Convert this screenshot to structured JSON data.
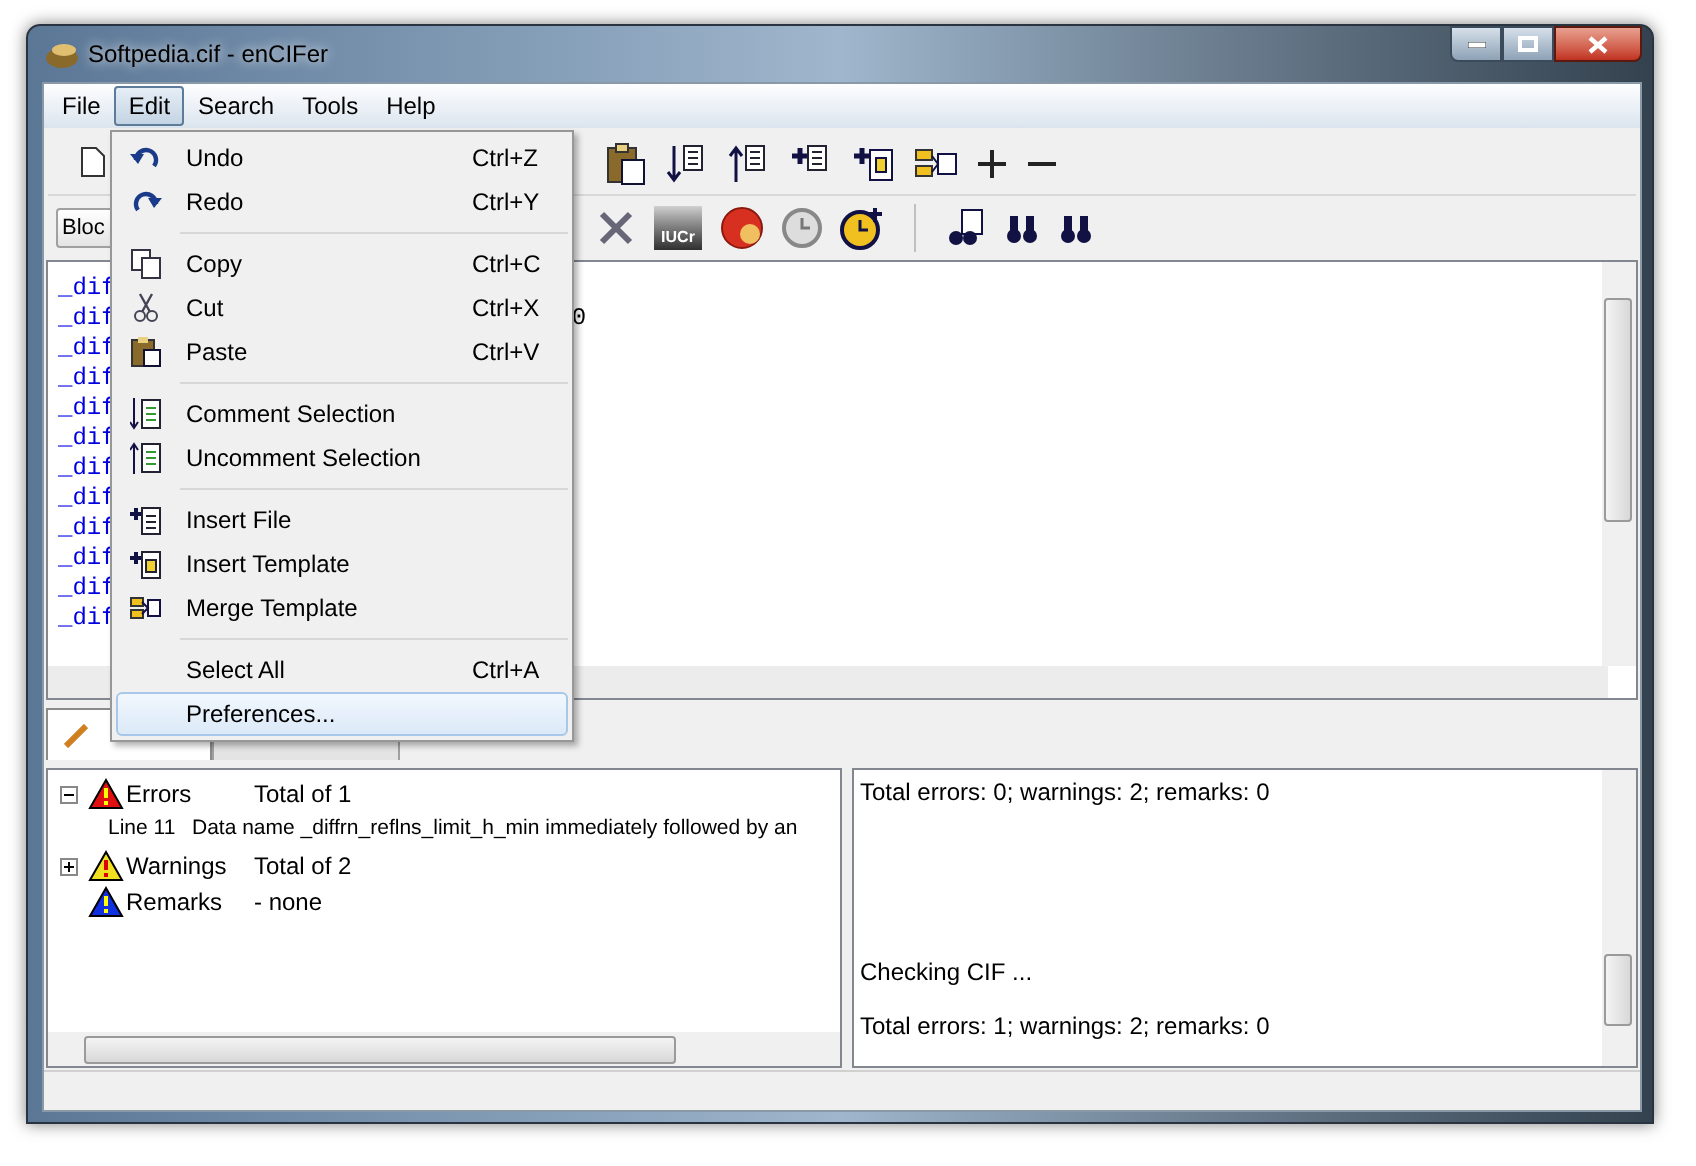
{
  "window": {
    "title": "Softpedia.cif - enCIFer"
  },
  "menu_bar": [
    {
      "label": "File",
      "selected": false
    },
    {
      "label": "Edit",
      "selected": true
    },
    {
      "label": "Search",
      "selected": false
    },
    {
      "label": "Tools",
      "selected": false
    },
    {
      "label": "Help",
      "selected": false
    }
  ],
  "toolbar_2": {
    "block_combo": "Bloc",
    "iucr_label": "IUCr"
  },
  "editor": {
    "lines": [
      {
        "text": "_dif"
      },
      {
        "text": "_dif",
        "tail": "0"
      },
      {
        "text": "_dif"
      },
      {
        "text": "_dif"
      },
      {
        "text": "_dif"
      },
      {
        "text": "_dif"
      },
      {
        "text": "_dif"
      },
      {
        "text": "_dif"
      },
      {
        "text": "_dif"
      },
      {
        "text": "_dif"
      },
      {
        "text": "_dif"
      },
      {
        "text": "_dif"
      }
    ]
  },
  "tabs": [
    {
      "selected": true
    },
    {
      "selected": false
    }
  ],
  "edit_menu": [
    {
      "kind": "item",
      "label": "Undo",
      "shortcut": "Ctrl+Z",
      "selected": false
    },
    {
      "kind": "item",
      "label": "Redo",
      "shortcut": "Ctrl+Y",
      "selected": false
    },
    {
      "kind": "separator"
    },
    {
      "kind": "item",
      "label": "Copy",
      "shortcut": "Ctrl+C",
      "selected": false
    },
    {
      "kind": "item",
      "label": "Cut",
      "shortcut": "Ctrl+X",
      "selected": false
    },
    {
      "kind": "item",
      "label": "Paste",
      "shortcut": "Ctrl+V",
      "selected": false
    },
    {
      "kind": "separator"
    },
    {
      "kind": "item",
      "label": "Comment Selection",
      "selected": false
    },
    {
      "kind": "item",
      "label": "Uncomment Selection",
      "selected": false
    },
    {
      "kind": "separator"
    },
    {
      "kind": "item",
      "label": "Insert File",
      "selected": false
    },
    {
      "kind": "item",
      "label": "Insert Template",
      "selected": false
    },
    {
      "kind": "item",
      "label": "Merge Template",
      "selected": false
    },
    {
      "kind": "separator"
    },
    {
      "kind": "item",
      "label": "Select All",
      "shortcut": "Ctrl+A",
      "selected": false
    },
    {
      "kind": "item",
      "label": "Preferences...",
      "selected": true
    }
  ],
  "validation_tree": [
    {
      "kind": "error",
      "label": "Errors",
      "summary": "Total of 1",
      "expanded": true,
      "children": [
        {
          "label": "Line 11",
          "message": "Data name _diffrn_reflns_limit_h_min immediately followed by an"
        }
      ]
    },
    {
      "kind": "warning",
      "label": "Warnings",
      "summary": "Total of 2",
      "expanded": false
    },
    {
      "kind": "remark",
      "label": "Remarks",
      "summary": "- none"
    }
  ],
  "log": [
    {
      "lines": [
        "Total errors: 0; warnings: 2; remarks: 0"
      ]
    },
    {
      "lines": [
        "Checking CIF ...",
        "Total errors: 1; warnings: 2; remarks: 0"
      ]
    }
  ]
}
